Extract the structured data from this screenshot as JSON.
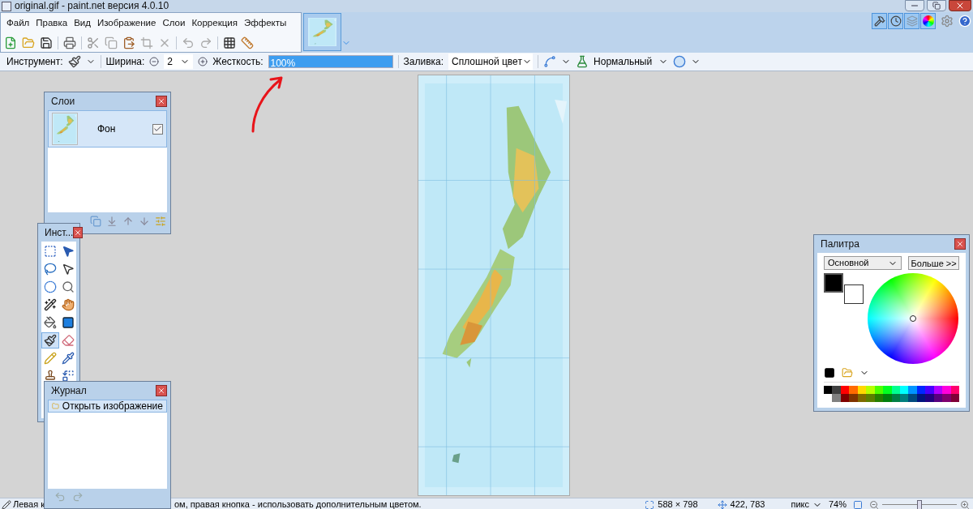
{
  "window": {
    "title": "original.gif - paint.net версия 4.0.10"
  },
  "menu": [
    "Файл",
    "Правка",
    "Вид",
    "Изображение",
    "Слои",
    "Коррекция",
    "Эффекты"
  ],
  "image_tabs": [
    {
      "kind": "picture",
      "selected": true
    }
  ],
  "view_toggles": [
    {
      "kind": "tools",
      "selected": true
    },
    {
      "kind": "history",
      "selected": true
    },
    {
      "kind": "layers",
      "selected": true
    },
    {
      "kind": "colors",
      "selected": true
    }
  ],
  "tool_options": {
    "tool_label": "Инструмент:",
    "width_label": "Ширина:",
    "width_value": "2",
    "hardness_label": "Жесткость:",
    "hardness": {
      "value": "100%",
      "level": 1
    },
    "fill_label": "Заливка:",
    "fill_value": "Сплошной цвет",
    "blend_mode": "Нормальный"
  },
  "layers_window": {
    "title": "Слои",
    "layers": [
      {
        "name": "Фон",
        "visible": true,
        "selected": true
      }
    ]
  },
  "tools_window": {
    "title": "Инст...",
    "tools": [
      {
        "kind": "rect-select",
        "selected": false
      },
      {
        "kind": "move",
        "selected": false
      },
      {
        "kind": "lasso",
        "selected": false
      },
      {
        "kind": "move-selection",
        "selected": false
      },
      {
        "kind": "ellipse-select",
        "selected": false
      },
      {
        "kind": "zoom",
        "selected": false
      },
      {
        "kind": "magic-wand",
        "selected": false
      },
      {
        "kind": "pan",
        "selected": false
      },
      {
        "kind": "bucket",
        "selected": false
      },
      {
        "kind": "gradient",
        "selected": false
      },
      {
        "kind": "brush",
        "selected": true
      },
      {
        "kind": "eraser",
        "selected": false
      },
      {
        "kind": "pencil",
        "selected": false
      },
      {
        "kind": "picker",
        "selected": false
      },
      {
        "kind": "stamp",
        "selected": false
      },
      {
        "kind": "recolor",
        "selected": false
      }
    ]
  },
  "history_window": {
    "title": "Журнал",
    "items": [
      {
        "label": "Открыть изображение",
        "selected": true
      }
    ]
  },
  "palette_window": {
    "title": "Палитра",
    "palette_select": "Основной",
    "more_button": "Больше >>",
    "active_colors": [
      {
        "kind": "primary",
        "color": "#000000"
      },
      {
        "kind": "secondary",
        "color": "#ffffff"
      }
    ],
    "swatches": [
      {
        "color": "#000000"
      },
      {
        "color": "#404040"
      },
      {
        "color": "#ff0000"
      },
      {
        "color": "#ff6a00"
      },
      {
        "color": "#ffd800"
      },
      {
        "color": "#b6ff00"
      },
      {
        "color": "#4cff00"
      },
      {
        "color": "#00ff21"
      },
      {
        "color": "#00ff90"
      },
      {
        "color": "#00ffff"
      },
      {
        "color": "#0094ff"
      },
      {
        "color": "#0026ff"
      },
      {
        "color": "#4800ff"
      },
      {
        "color": "#b200ff"
      },
      {
        "color": "#ff00dc"
      },
      {
        "color": "#ff006e"
      },
      {
        "color": "#808080"
      },
      {
        "color": "#7f0000"
      },
      {
        "color": "#7f3300"
      },
      {
        "color": "#7f6a00"
      },
      {
        "color": "#5b7f00"
      },
      {
        "color": "#267f00"
      },
      {
        "color": "#007f0e"
      },
      {
        "color": "#007f46"
      },
      {
        "color": "#007f7f"
      },
      {
        "color": "#004a7f"
      },
      {
        "color": "#00137f"
      },
      {
        "color": "#21007f"
      },
      {
        "color": "#57007f"
      },
      {
        "color": "#7f006e"
      },
      {
        "color": "#7f0037"
      }
    ]
  },
  "status_bar": {
    "hint_start": "Левая к",
    "hint_end": "ом, правая кнопка - использовать дополнительным цветом.",
    "image_size": "588 × 798",
    "cursor_position": "422, 783",
    "units": "пикс",
    "zoom": "74%",
    "zoom_slider": {
      "level": 0.5
    }
  }
}
